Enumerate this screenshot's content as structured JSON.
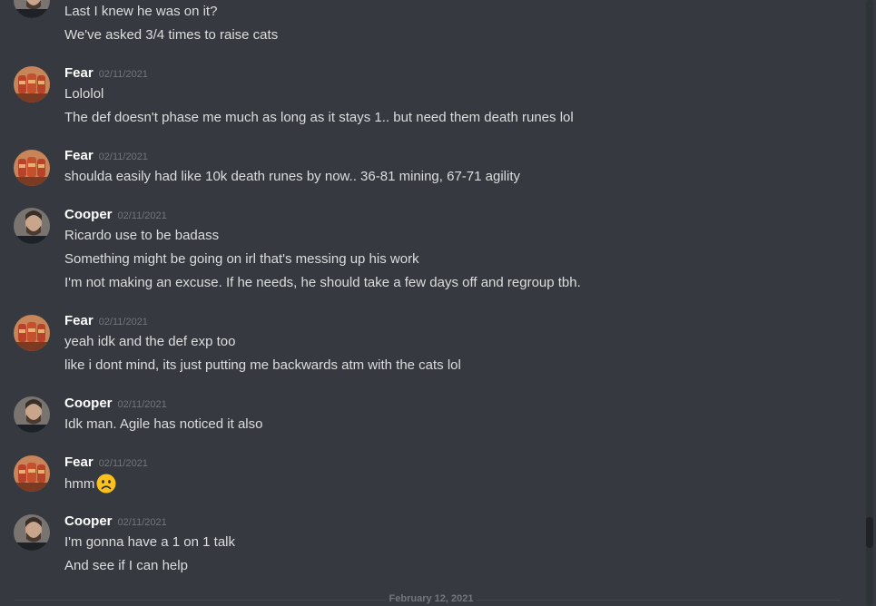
{
  "channel": {
    "continued": {
      "lines": [
        "Last I knew he was on it?",
        "We've asked 3/4 times to raise cats"
      ]
    },
    "messages": [
      {
        "author": "Fear",
        "timestamp": "02/11/2021",
        "avatar": "fear-avatar",
        "lines": [
          "Lololol",
          "The def doesn't phase me much as long as it stays 1.. but need them death runes lol"
        ]
      },
      {
        "author": "Fear",
        "timestamp": "02/11/2021",
        "avatar": "fear-avatar",
        "lines": [
          "shoulda easily had like 10k death runes by now.. 36-81 mining, 67-71 agility"
        ]
      },
      {
        "author": "Cooper",
        "timestamp": "02/11/2021",
        "avatar": "cooper-avatar",
        "lines": [
          "Ricardo use to be badass",
          "Something might be going on irl that's messing up his work",
          "I'm not making an excuse. If he needs, he should take a few days off and regroup tbh."
        ]
      },
      {
        "author": "Fear",
        "timestamp": "02/11/2021",
        "avatar": "fear-avatar",
        "lines": [
          "yeah idk and the def exp too",
          "like i dont mind, its just putting me backwards atm with the cats lol"
        ]
      },
      {
        "author": "Cooper",
        "timestamp": "02/11/2021",
        "avatar": "cooper-avatar",
        "lines": [
          "Idk man. Agile has noticed it also"
        ]
      },
      {
        "author": "Fear",
        "timestamp": "02/11/2021",
        "avatar": "fear-avatar",
        "lines": [
          "hmm"
        ],
        "emoji": "frowning-face-emoji"
      },
      {
        "author": "Cooper",
        "timestamp": "02/11/2021",
        "avatar": "cooper-avatar",
        "lines": [
          "I'm gonna have a 1 on 1 talk",
          "And see if I can help"
        ]
      }
    ],
    "date_divider": "February 12, 2021"
  },
  "colors": {
    "background": "#36393f",
    "author": "#ffffff",
    "text": "#dcddde",
    "timestamp": "#72767d"
  }
}
